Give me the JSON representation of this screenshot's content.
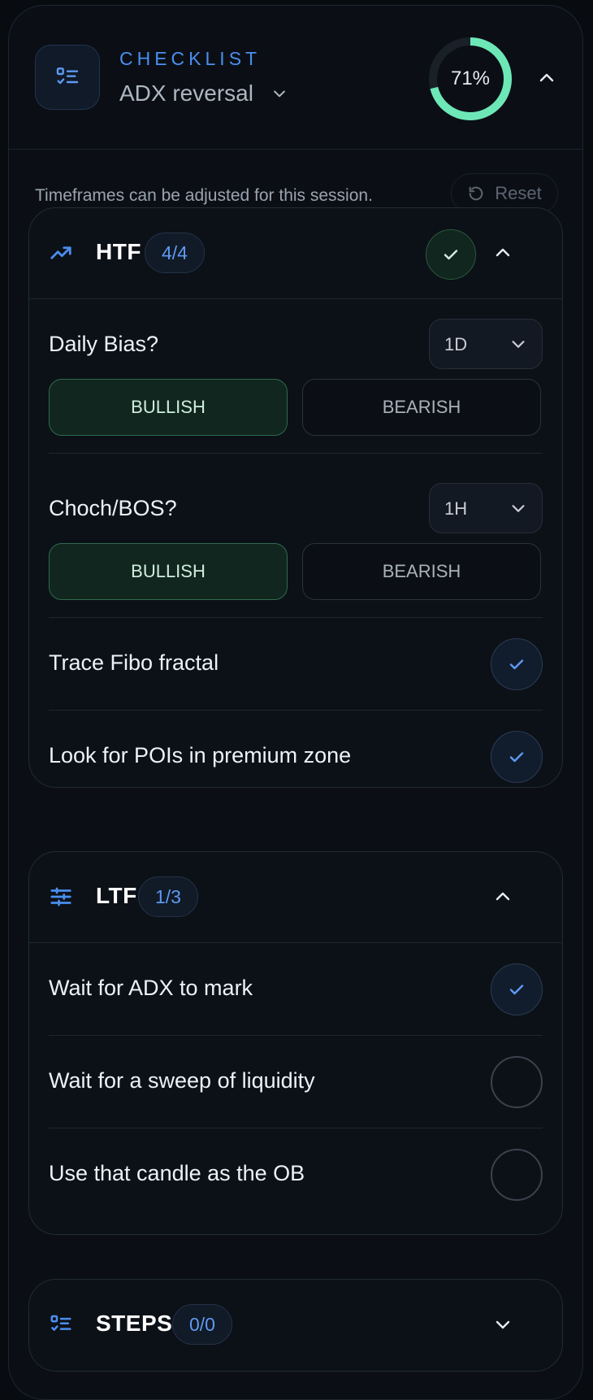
{
  "header": {
    "eyebrow": "CHECKLIST",
    "title": "ADX reversal",
    "progress_text": "71%",
    "progress_fraction": 0.71,
    "logo_icon": "checklist-icon"
  },
  "notice": "Timeframes can be adjusted for this session.",
  "reset_label": "Reset",
  "colors": {
    "accent": "#4a8ef0",
    "progress": "#6ee7b7",
    "bullish_border": "#2f6b4e"
  },
  "sections": {
    "htf": {
      "title": "HTF",
      "count": "4/4",
      "icon": "trending-up-icon",
      "items": [
        {
          "label": "Daily Bias?",
          "timeframe": "1D",
          "options": [
            "BULLISH",
            "BEARISH"
          ],
          "selected": "BULLISH"
        },
        {
          "label": "Choch/BOS?",
          "timeframe": "1H",
          "options": [
            "BULLISH",
            "BEARISH"
          ],
          "selected": "BULLISH"
        },
        {
          "label": "Trace Fibo fractal",
          "checked": true
        },
        {
          "label": "Look for POIs in premium zone",
          "checked": true
        }
      ]
    },
    "ltf": {
      "title": "LTF",
      "count": "1/3",
      "icon": "sliders-icon",
      "items": [
        {
          "label": "Wait for ADX to mark",
          "checked": true
        },
        {
          "label": "Wait for a sweep of liquidity",
          "checked": false
        },
        {
          "label": "Use that candle as the OB",
          "checked": false
        }
      ]
    },
    "steps": {
      "title": "STEPS",
      "count": "0/0",
      "icon": "checklist-icon"
    }
  }
}
